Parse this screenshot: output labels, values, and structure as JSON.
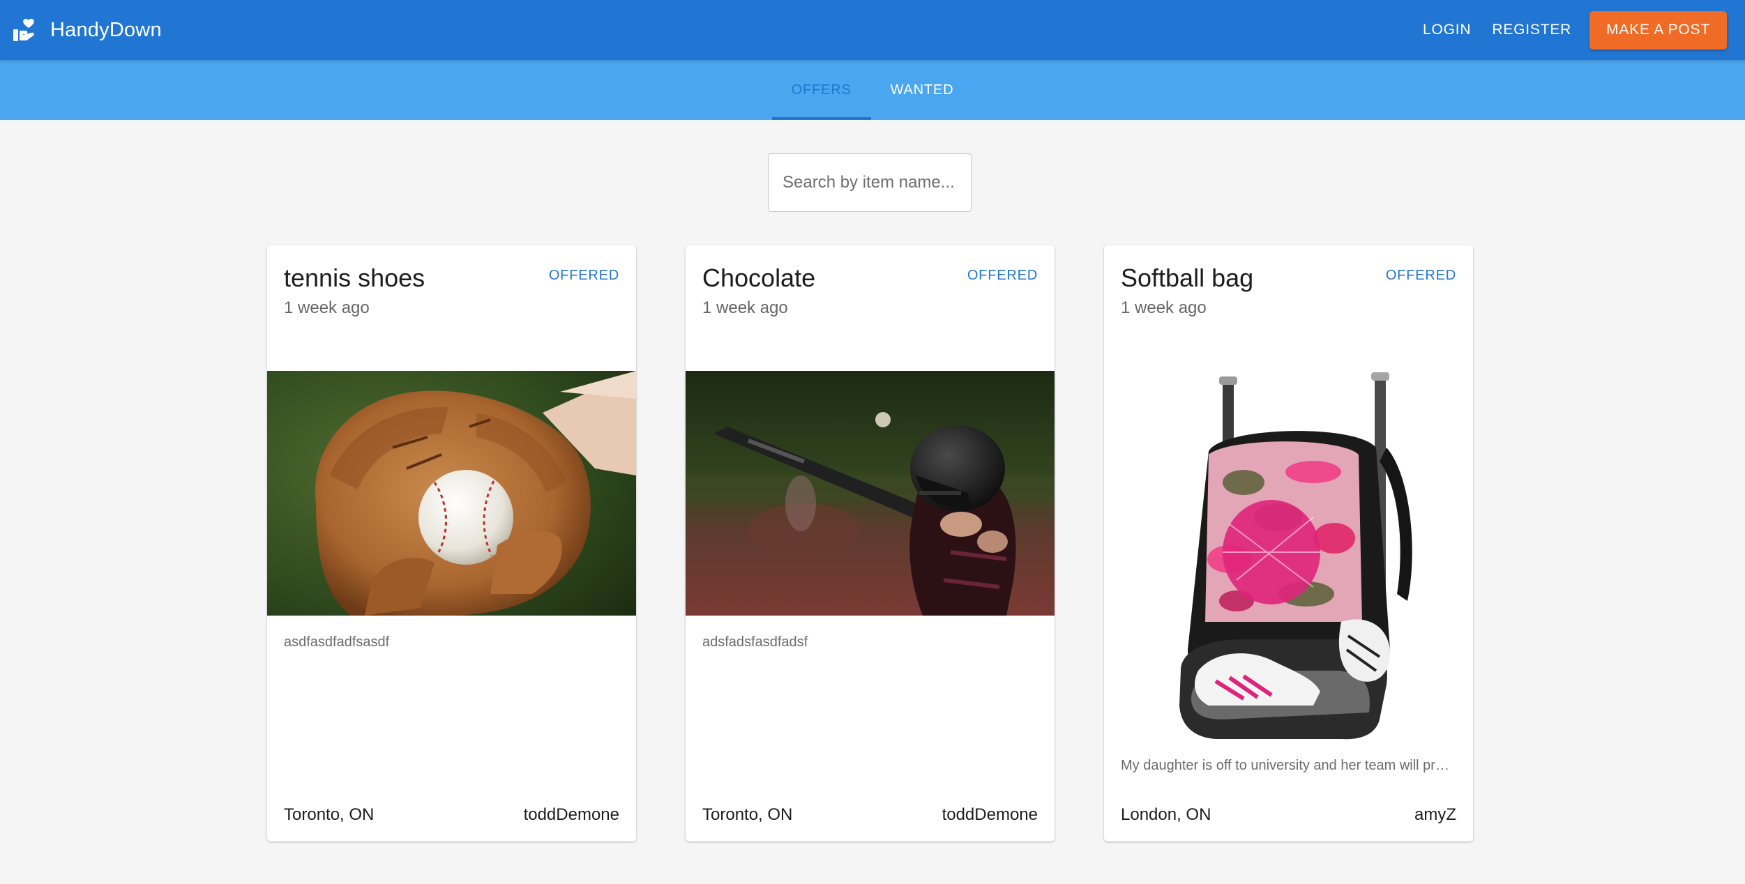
{
  "app": {
    "brand": "HandyDown",
    "logo_icon": "hands-heart-icon"
  },
  "header": {
    "login_label": "LOGIN",
    "register_label": "REGISTER",
    "post_label": "MAKE A POST"
  },
  "tabs": [
    {
      "label": "OFFERS",
      "active": true
    },
    {
      "label": "WANTED",
      "active": false
    }
  ],
  "search": {
    "placeholder": "Search by item name...",
    "value": ""
  },
  "colors": {
    "appbar": "#2176d3",
    "tabbar": "#4aa6ef",
    "accent": "#ef6b26",
    "badge": "#2176d3"
  },
  "posts": [
    {
      "title": "tennis shoes",
      "time": "1 week ago",
      "status": "OFFERED",
      "image": "baseball-glove-photo",
      "description": "asdfasdfadfsasdf",
      "location": "Toronto, ON",
      "user": "toddDemone"
    },
    {
      "title": "Chocolate",
      "time": "1 week ago",
      "status": "OFFERED",
      "image": "child-batter-photo",
      "description": "adsfadsfasdfadsf",
      "location": "Toronto, ON",
      "user": "toddDemone"
    },
    {
      "title": "Softball bag",
      "time": "1 week ago",
      "status": "OFFERED",
      "image": "softball-backpack-photo",
      "description": "My daughter is off to university and her team will provide a new bag, so this one is up for grabs.",
      "location": "London, ON",
      "user": "amyZ"
    }
  ]
}
